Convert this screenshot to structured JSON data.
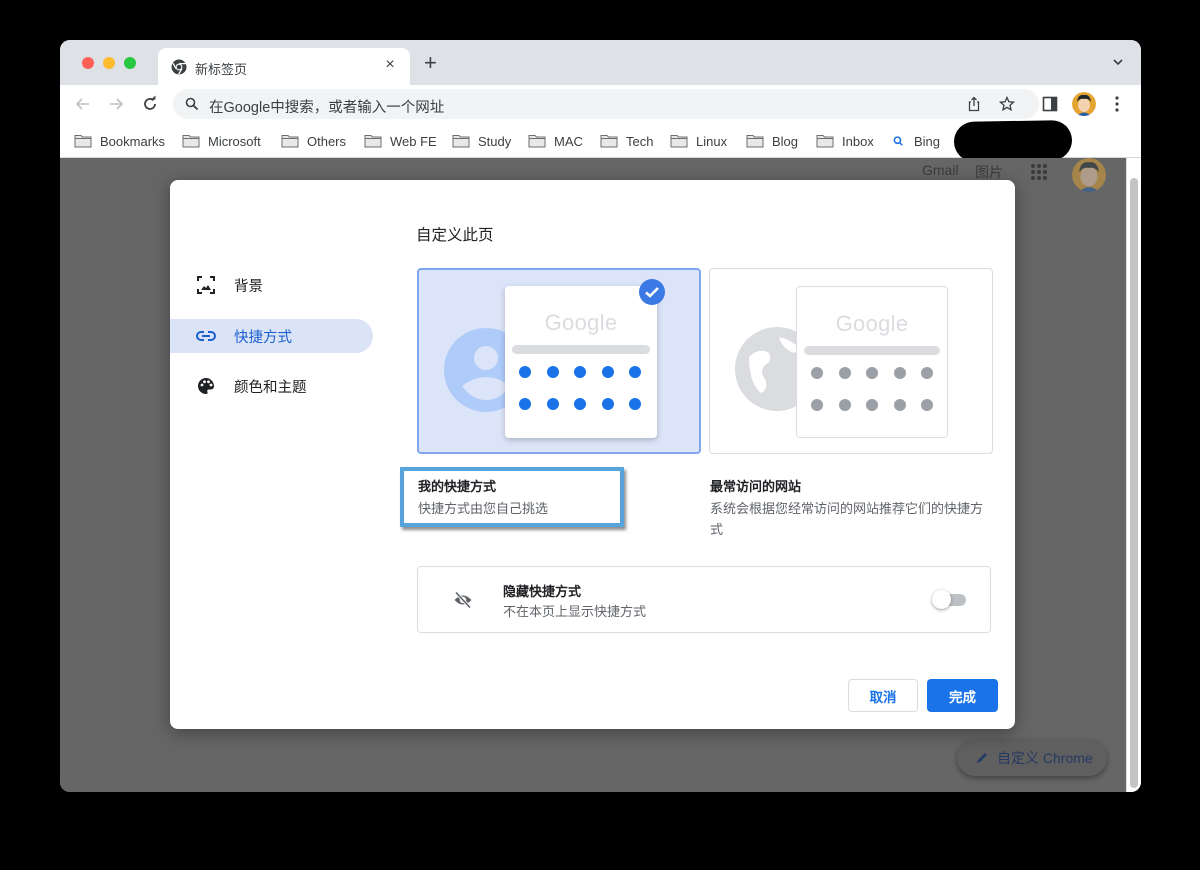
{
  "browser": {
    "tab": {
      "title": "新标签页",
      "close_glyph": "×",
      "favicon": "chrome-icon"
    },
    "new_tab_glyph": "+",
    "omnibox": {
      "placeholder": "在Google中搜索，或者输入一个网址"
    },
    "bookmarks": [
      {
        "label": "Bookmarks",
        "icon": "folder-icon"
      },
      {
        "label": "Microsoft",
        "icon": "folder-icon"
      },
      {
        "label": "Others",
        "icon": "folder-icon"
      },
      {
        "label": "Web FE",
        "icon": "folder-icon"
      },
      {
        "label": "Study",
        "icon": "folder-icon"
      },
      {
        "label": "MAC",
        "icon": "folder-icon"
      },
      {
        "label": "Tech",
        "icon": "folder-icon"
      },
      {
        "label": "Linux",
        "icon": "folder-icon"
      },
      {
        "label": "Blog",
        "icon": "folder-icon"
      },
      {
        "label": "Inbox",
        "icon": "folder-icon"
      },
      {
        "label": "Bing",
        "icon": "search-icon"
      }
    ]
  },
  "ntp": {
    "gmail_label": "Gmail",
    "images_label": "图片",
    "customize_label": "自定义 Chrome"
  },
  "dialog": {
    "sidebar": [
      {
        "label": "背景",
        "icon": "background-icon",
        "active": false
      },
      {
        "label": "快捷方式",
        "icon": "link-icon",
        "active": true
      },
      {
        "label": "颜色和主题",
        "icon": "palette-icon",
        "active": false
      }
    ],
    "title": "自定义此页",
    "options": [
      {
        "label": "我的快捷方式",
        "description": "快捷方式由您自己挑选",
        "selected": true,
        "preview_text": "Google"
      },
      {
        "label": "最常访问的网站",
        "description": "系统会根据您经常访问的网站推荐它们的快捷方式",
        "selected": false,
        "preview_text": "Google"
      }
    ],
    "hide_shortcuts": {
      "title": "隐藏快捷方式",
      "description": "不在本页上显示快捷方式",
      "enabled": false
    },
    "cancel_label": "取消",
    "done_label": "完成"
  },
  "colors": {
    "accent": "#1a73e8",
    "selected_option_bg": "#dbe4f8",
    "highlight_box": "#57a3dc"
  }
}
